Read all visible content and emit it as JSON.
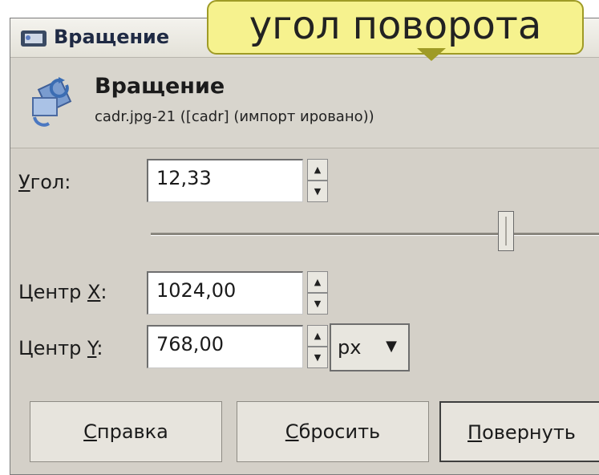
{
  "window": {
    "title": "Вращение"
  },
  "header": {
    "title": "Вращение",
    "subtitle": "cadr.jpg-21 ([cadr] (импорт ировано))"
  },
  "fields": {
    "angle": {
      "label_pre": "",
      "label_acc": "У",
      "label_post": "гол:",
      "value": "12,33"
    },
    "center_x": {
      "label_pre": "Центр ",
      "label_acc": "X",
      "label_post": ":",
      "value": "1024,00"
    },
    "center_y": {
      "label_pre": "Центр ",
      "label_acc": "Y",
      "label_post": ":",
      "value": "768,00"
    }
  },
  "slider": {
    "level": 0.77
  },
  "units": {
    "selected": "px",
    "arrow_icon": "triangle-down"
  },
  "buttons": {
    "help": {
      "acc": "С",
      "rest": "правка"
    },
    "reset": {
      "acc": "С",
      "rest": "бросить"
    },
    "rotate": {
      "acc": "П",
      "rest": "овернуть"
    }
  },
  "callout": {
    "text": "угол поворота"
  },
  "colors": {
    "dialog_bg": "#d4d0c8",
    "callout_bg": "#f6f28e"
  }
}
